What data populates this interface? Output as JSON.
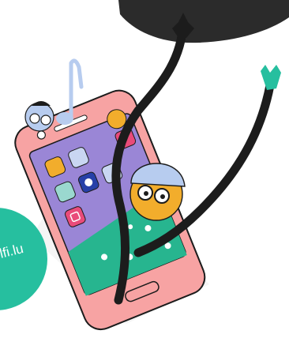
{
  "badge": {
    "text": "lfi.lu"
  },
  "colors": {
    "blob": "#2b2b2b",
    "teal": "#26bf9f",
    "phone_pink": "#f7a3a3",
    "screen_purple": "#9a86d6",
    "screen_green": "#27b58f",
    "line": "#1c1c1c",
    "hat_blue": "#b7ccef",
    "face_yellow": "#f2ad2c"
  }
}
